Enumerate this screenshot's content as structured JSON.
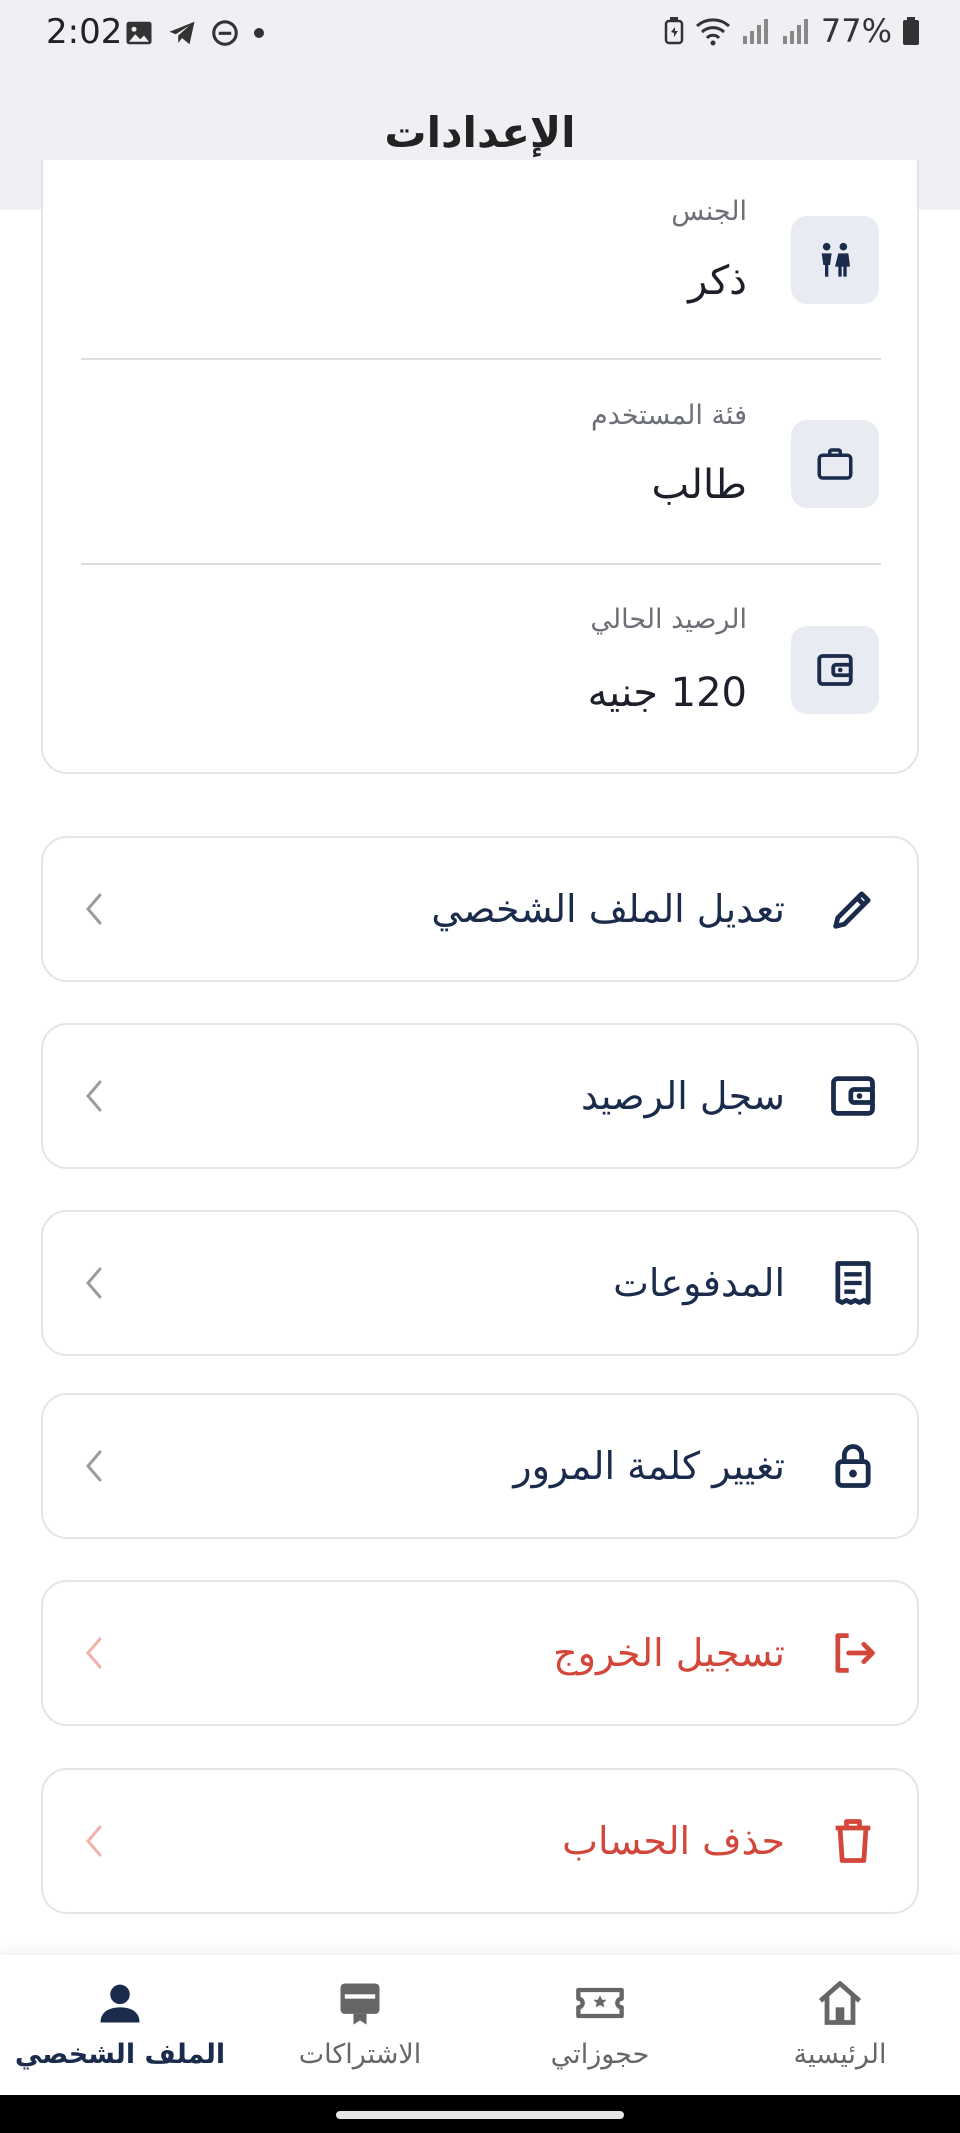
{
  "status_bar": {
    "time": "2:02",
    "battery": "77%"
  },
  "header": {
    "title": "الإعدادات"
  },
  "info": {
    "gender": {
      "label": "الجنس",
      "value": "ذكر",
      "icon": "gender-icon"
    },
    "category": {
      "label": "فئة المستخدم",
      "value": "طالب",
      "icon": "briefcase-icon"
    },
    "balance": {
      "label": "الرصيد الحالي",
      "value": "120 جنيه",
      "icon": "wallet-icon"
    }
  },
  "menu": {
    "edit_profile": {
      "label": "تعديل الملف الشخصي",
      "icon": "pencil-icon"
    },
    "balance_history": {
      "label": "سجل الرصيد",
      "icon": "wallet-icon"
    },
    "payments": {
      "label": "المدفوعات",
      "icon": "receipt-icon"
    },
    "change_password": {
      "label": "تغيير كلمة المرور",
      "icon": "lock-icon"
    },
    "logout": {
      "label": "تسجيل الخروج",
      "icon": "logout-icon"
    },
    "delete_account": {
      "label": "حذف الحساب",
      "icon": "trash-icon"
    }
  },
  "colors": {
    "primary": "#1a2b4c",
    "danger": "#d2473a",
    "icon_bg": "#e8ebf1"
  },
  "bottom_nav": {
    "profile": "الملف الشخصي",
    "subscriptions": "الاشتراكات",
    "bookings": "حجوزاتي",
    "home": "الرئيسية"
  }
}
